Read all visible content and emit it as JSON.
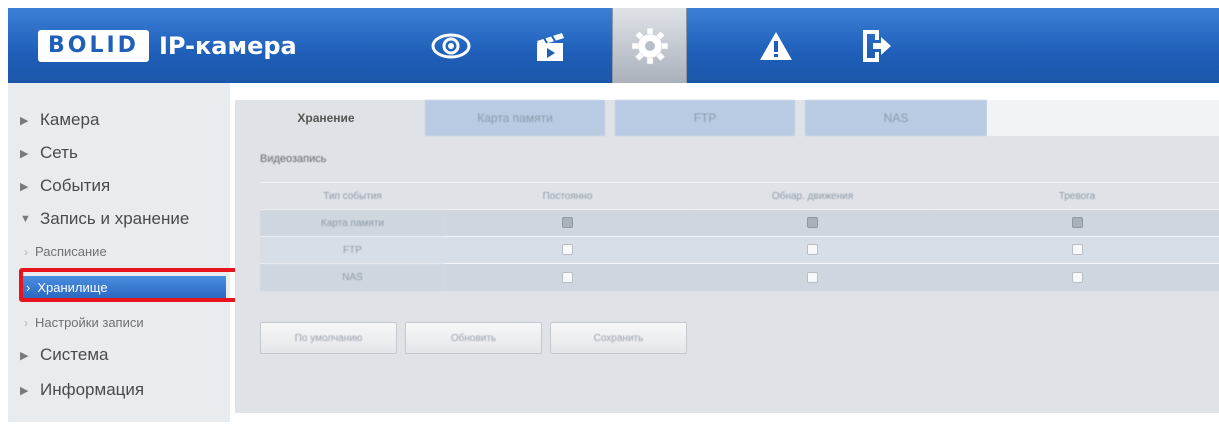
{
  "header": {
    "logo": "BOLID",
    "title": "IP-камера",
    "nav_icons": [
      "eye-icon",
      "clapperboard-icon",
      "gear-icon",
      "warning-icon",
      "logout-icon"
    ],
    "active_icon": "gear-icon"
  },
  "sidebar": {
    "items": [
      {
        "label": "Камера",
        "expanded": false
      },
      {
        "label": "Сеть",
        "expanded": false
      },
      {
        "label": "События",
        "expanded": false
      },
      {
        "label": "Запись и хранение",
        "expanded": true
      },
      {
        "label": "Система",
        "expanded": false
      },
      {
        "label": "Информация",
        "expanded": false
      }
    ],
    "sub_items": [
      {
        "label": "Расписание"
      },
      {
        "label": "Хранилище",
        "selected": true
      },
      {
        "label": "Настройки записи"
      }
    ]
  },
  "main": {
    "tabs": [
      {
        "label": "Хранение",
        "active": true
      },
      {
        "label": "Карта памяти",
        "active": false
      },
      {
        "label": "FTP",
        "active": false
      },
      {
        "label": "NAS",
        "active": false
      }
    ],
    "section_title": "Видеозапись",
    "table": {
      "columns": [
        "Тип события",
        "Постоянно",
        "Обнар. движения",
        "Тревога"
      ],
      "rows": [
        {
          "label": "Карта памяти",
          "values": [
            true,
            true,
            true
          ]
        },
        {
          "label": "FTP",
          "values": [
            false,
            false,
            false
          ]
        },
        {
          "label": "NAS",
          "values": [
            false,
            false,
            false
          ]
        }
      ]
    },
    "buttons": {
      "default": "По умолчанию",
      "refresh": "Обновить",
      "save": "Сохранить"
    }
  },
  "colors": {
    "header_blue": "#1f5fb9",
    "selection_blue": "#2b68c2",
    "highlight_red": "#e8141b"
  }
}
